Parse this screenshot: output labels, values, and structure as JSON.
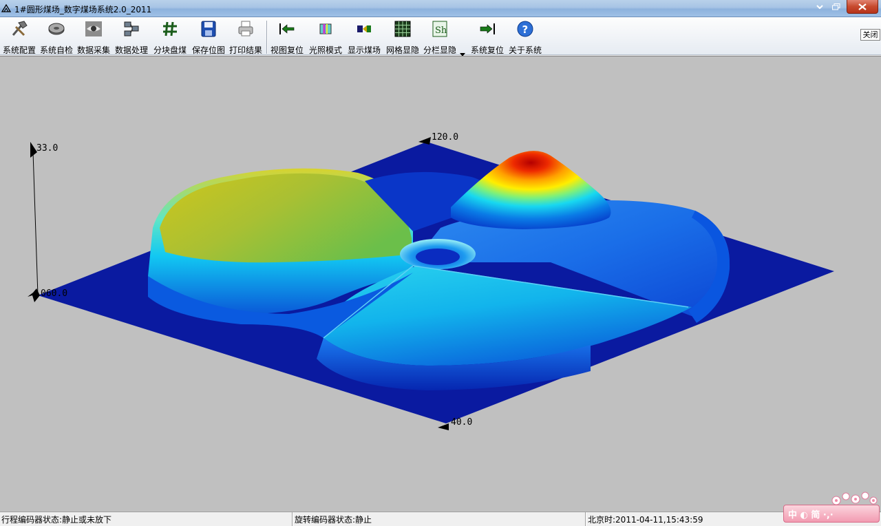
{
  "window": {
    "title": "1#圆形煤场_数字煤场系统2.0_2011"
  },
  "toolbar": {
    "group1": [
      {
        "label": "系统配置",
        "icon": "hammer-icon"
      },
      {
        "label": "系统自检",
        "icon": "disk-icon"
      },
      {
        "label": "数据采集",
        "icon": "eye-icon"
      },
      {
        "label": "数据处理",
        "icon": "network-icon"
      },
      {
        "label": "分块盘煤",
        "icon": "hash-icon"
      },
      {
        "label": "保存位图",
        "icon": "floppy-icon"
      },
      {
        "label": "打印结果",
        "icon": "printer-icon"
      }
    ],
    "group2": [
      {
        "label": "视图复位",
        "icon": "arrow-left-icon"
      },
      {
        "label": "光照模式",
        "icon": "light-icon"
      },
      {
        "label": "显示煤场",
        "icon": "arrow-right-icon"
      },
      {
        "label": "网格显隐",
        "icon": "grid-icon"
      },
      {
        "label": "分栏显隐",
        "icon": "sheet-icon"
      },
      {
        "label": "系统复位",
        "icon": "reset-icon"
      },
      {
        "label": "关于系统",
        "icon": "help-icon"
      }
    ],
    "close_label": "关闭"
  },
  "viewport": {
    "axis_top_label": "120.0",
    "axis_z_label": "33.0",
    "axis_origin_label": "060.0",
    "axis_bottom_label": "40.0"
  },
  "statusbar": {
    "travel_encoder": "行程编码器状态:静止或未放下",
    "rotary_encoder": "旋转编码器状态:静止",
    "beijing_time": "北京时:2011-04-11,15:43:59"
  },
  "ime": {
    "label": "中 ◐ 简 ·,·"
  }
}
